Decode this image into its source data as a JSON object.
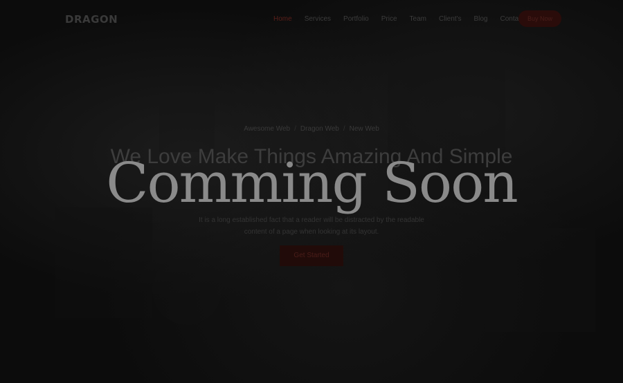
{
  "header": {
    "logo": "DRAGON",
    "nav": [
      {
        "label": "Home",
        "active": true
      },
      {
        "label": "Services"
      },
      {
        "label": "Portfolio"
      },
      {
        "label": "Price"
      },
      {
        "label": "Team"
      },
      {
        "label": "Client's"
      },
      {
        "label": "Blog"
      },
      {
        "label": "Contact"
      }
    ],
    "buy_label": "Buy Now"
  },
  "hero": {
    "breadcrumb": [
      "Awesome Web",
      "Dragon Web",
      "New Web"
    ],
    "title": "We Love Make Things Amazing And Simple",
    "text": "It is a long established fact that a reader will be distracted by the readable content of a page when looking at its layout.",
    "button_label": "Get Started"
  },
  "overlay": {
    "text": "Comming Soon"
  },
  "colors": {
    "accent": "#5a1f1a",
    "overlay_text": "#8a8a8a",
    "background": "#0c0c0c"
  }
}
